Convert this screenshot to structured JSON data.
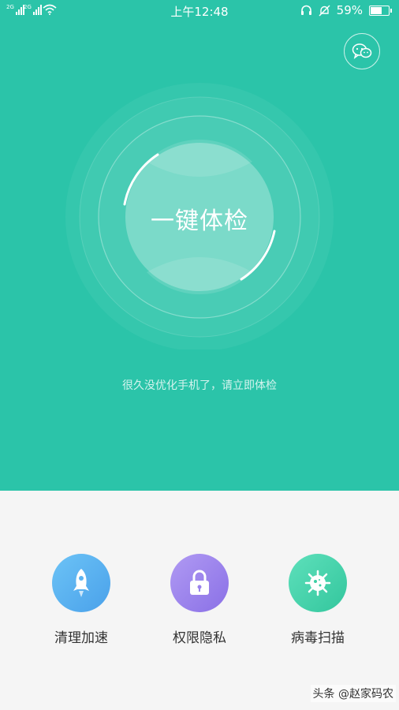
{
  "status_bar": {
    "sim1_tag": "2G",
    "sim2_tag": "2G",
    "time": "上午12:48",
    "battery_percent": "59%",
    "battery_level": 0.59,
    "icons": [
      "signal-icon",
      "signal-icon",
      "wifi-icon",
      "headset-icon",
      "mute-bell-icon",
      "battery-icon"
    ]
  },
  "header": {
    "wechat_icon": "wechat-icon"
  },
  "main": {
    "check_button_label": "一键体检",
    "hint": "很久没优化手机了，请立即体检"
  },
  "features": [
    {
      "label": "清理加速",
      "icon": "rocket-icon",
      "color_from": "#5fb8f3",
      "color_to": "#4aa3ea"
    },
    {
      "label": "权限隐私",
      "icon": "lock-icon",
      "color_from": "#a78cf0",
      "color_to": "#8d72e6"
    },
    {
      "label": "病毒扫描",
      "icon": "virus-icon",
      "color_from": "#4fd9b0",
      "color_to": "#36c9a0"
    }
  ],
  "watermark": "头条 @赵家码农",
  "colors": {
    "accent": "#2bc4a9",
    "background": "#f5f5f5"
  }
}
